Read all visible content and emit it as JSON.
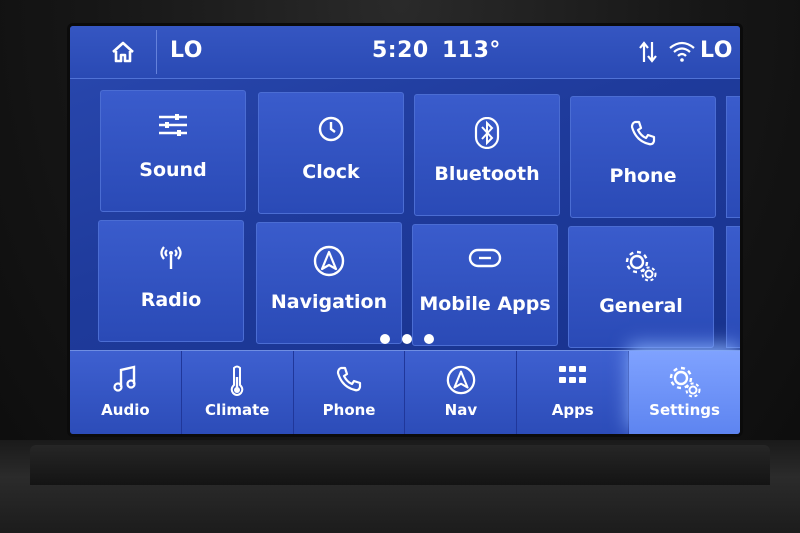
{
  "status_bar": {
    "fan_left": "LO",
    "time": "5:20",
    "temperature": "113°",
    "fan_right": "LO",
    "icons": [
      "home-icon",
      "sync-arrows-icon",
      "wifi-icon"
    ]
  },
  "tiles": [
    {
      "label": "Sound",
      "icon": "equalizer-sliders-icon"
    },
    {
      "label": "Clock",
      "icon": "clock-icon"
    },
    {
      "label": "Bluetooth",
      "icon": "bluetooth-icon"
    },
    {
      "label": "Phone",
      "icon": "phone-icon"
    },
    {
      "label": "Radio",
      "icon": "antenna-icon"
    },
    {
      "label": "Navigation",
      "icon": "navigation-arrow-icon"
    },
    {
      "label": "Mobile Apps",
      "icon": "link-icon"
    },
    {
      "label": "General",
      "icon": "gears-icon"
    }
  ],
  "page_indicator": {
    "count": 3
  },
  "nav": [
    {
      "label": "Audio",
      "icon": "music-note-icon"
    },
    {
      "label": "Climate",
      "icon": "thermometer-icon"
    },
    {
      "label": "Phone",
      "icon": "phone-icon"
    },
    {
      "label": "Nav",
      "icon": "navigation-arrow-icon"
    },
    {
      "label": "Apps",
      "icon": "apps-grid-icon"
    },
    {
      "label": "Settings",
      "icon": "gears-icon",
      "active": true
    }
  ],
  "colors": {
    "screen_bg": "#1f3b9c",
    "tile_bg": "#3a5ccc",
    "active_nav": "#7fa2ff"
  }
}
